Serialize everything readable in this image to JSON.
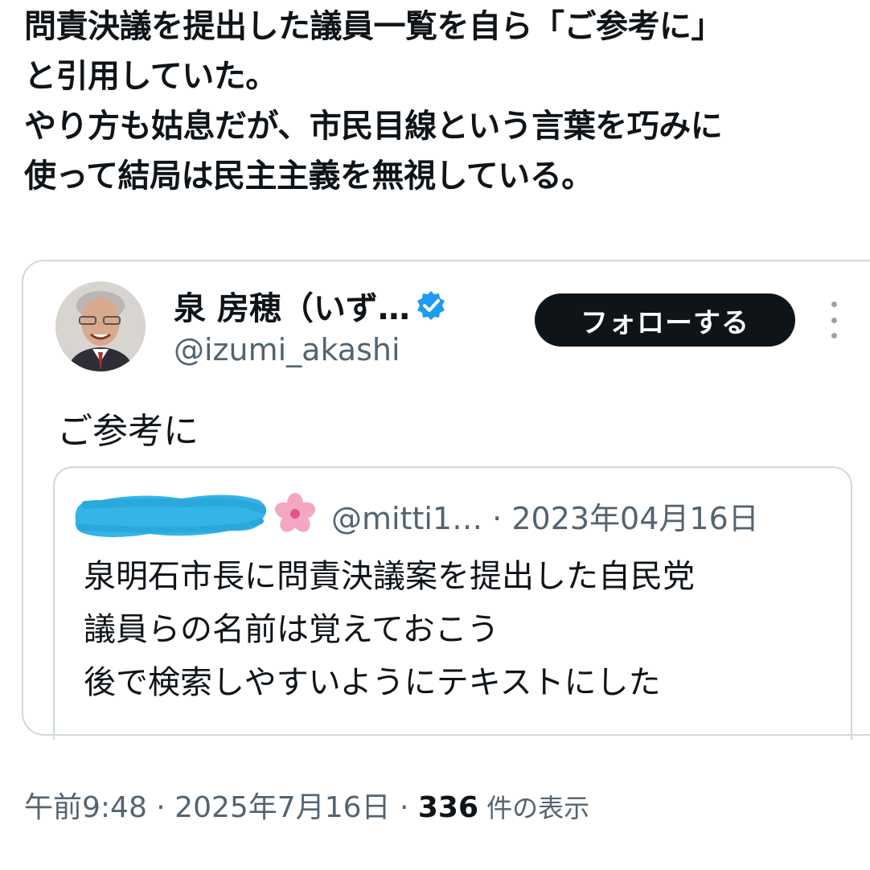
{
  "post": {
    "text_lines": [
      "問責決議を提出した議員一覧を自ら「ご参考に」",
      "と引用していた。",
      "やり方も姑息だが、市民目線という言葉を巧みに",
      "使って結局は民主主義を無視している。"
    ]
  },
  "quoted": {
    "author_name": "泉 房穂（いず…",
    "handle": "@izumi_akashi",
    "follow_label": "フォローする",
    "text": "ご参考に",
    "inner": {
      "handle_date": "@mitti1… · 2023年04月16日",
      "text_lines": [
        "泉明石市長に問責決議案を提出した自民党",
        "議員らの名前は覚えておこう",
        "後で検索しやすいようにテキストにした"
      ]
    }
  },
  "meta": {
    "time_date": "午前9:48 · 2025年7月16日 · ",
    "views": "336",
    "views_label": " 件の表示"
  },
  "colors": {
    "text": "#0f1419",
    "secondary": "#536471",
    "border": "#cfd9de",
    "verified": "#1d9bf0",
    "redaction": "#33b5e8"
  },
  "icons": [
    "verified-badge-icon",
    "more-options-icon",
    "cherry-blossom-icon"
  ]
}
